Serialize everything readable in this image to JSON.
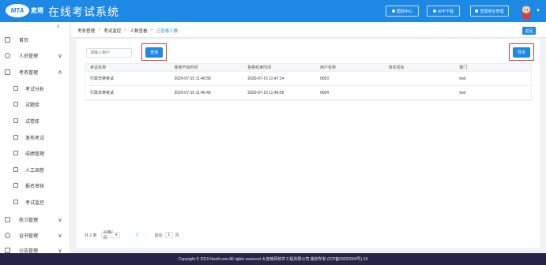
{
  "header": {
    "logo_text": "MTA",
    "logo_suffix": "麦塔",
    "title": "在线考试系统",
    "buttons": [
      {
        "label": "帮助中心",
        "icon": "help-icon"
      },
      {
        "label": "APP下载",
        "icon": "download-icon"
      },
      {
        "label": "登录地址管理",
        "icon": "address-icon"
      }
    ]
  },
  "sidebar": {
    "items": [
      {
        "label": "首页",
        "icon": "home-icon"
      },
      {
        "label": "人员管理",
        "icon": "user-icon",
        "arrow": "∨"
      },
      {
        "label": "考务管理",
        "icon": "exam-icon",
        "arrow": "∧"
      },
      {
        "label": "考试分析",
        "icon": "analysis-icon"
      },
      {
        "label": "试题库",
        "icon": "question-bank-icon"
      },
      {
        "label": "试卷库",
        "icon": "paper-bank-icon"
      },
      {
        "label": "发布考试",
        "icon": "publish-icon"
      },
      {
        "label": "成绩管理",
        "icon": "score-icon"
      },
      {
        "label": "人工阅卷",
        "icon": "grading-icon"
      },
      {
        "label": "报名审核",
        "icon": "review-icon"
      },
      {
        "label": "考试监控",
        "icon": "monitor-icon"
      },
      {
        "label": "练习管理",
        "icon": "practice-icon",
        "arrow": "∨"
      },
      {
        "label": "证书管理",
        "icon": "certificate-icon",
        "arrow": "∨"
      },
      {
        "label": "公告管理",
        "icon": "notice-icon",
        "arrow": "∨"
      }
    ]
  },
  "breadcrumb": [
    "考务管理",
    "考试监控",
    "人数查看",
    "已答卷人数"
  ],
  "back_label": "返回",
  "search": {
    "placeholder": "请输入用户"
  },
  "query_label": "查询",
  "export_label": "导出",
  "table": {
    "headers": [
      "考试名称",
      "答卷开始时间",
      "答卷结束时间",
      "用户名称",
      "真实姓名",
      "部门"
    ],
    "rows": [
      [
        "行政日常考试",
        "2020-07-15 11:46:58",
        "2020-07-15 11:47:14",
        "0003",
        "",
        "test"
      ],
      [
        "行政日常考试",
        "2020-07-15 11:46:49",
        "2020-07-15 11:46:59",
        "0004",
        "",
        "test"
      ]
    ]
  },
  "pagination": {
    "total_text": "共 2 条",
    "page_size": "10条/页",
    "current_page": "1",
    "goto_label": "前往",
    "goto_value": "1",
    "page_unit": "页"
  },
  "footer": {
    "text": "Copyright © 2019 Itisoft.com All rights reserved 大连格网软件工程有限公司 版权所有 (ICP备09025904号)-19"
  }
}
